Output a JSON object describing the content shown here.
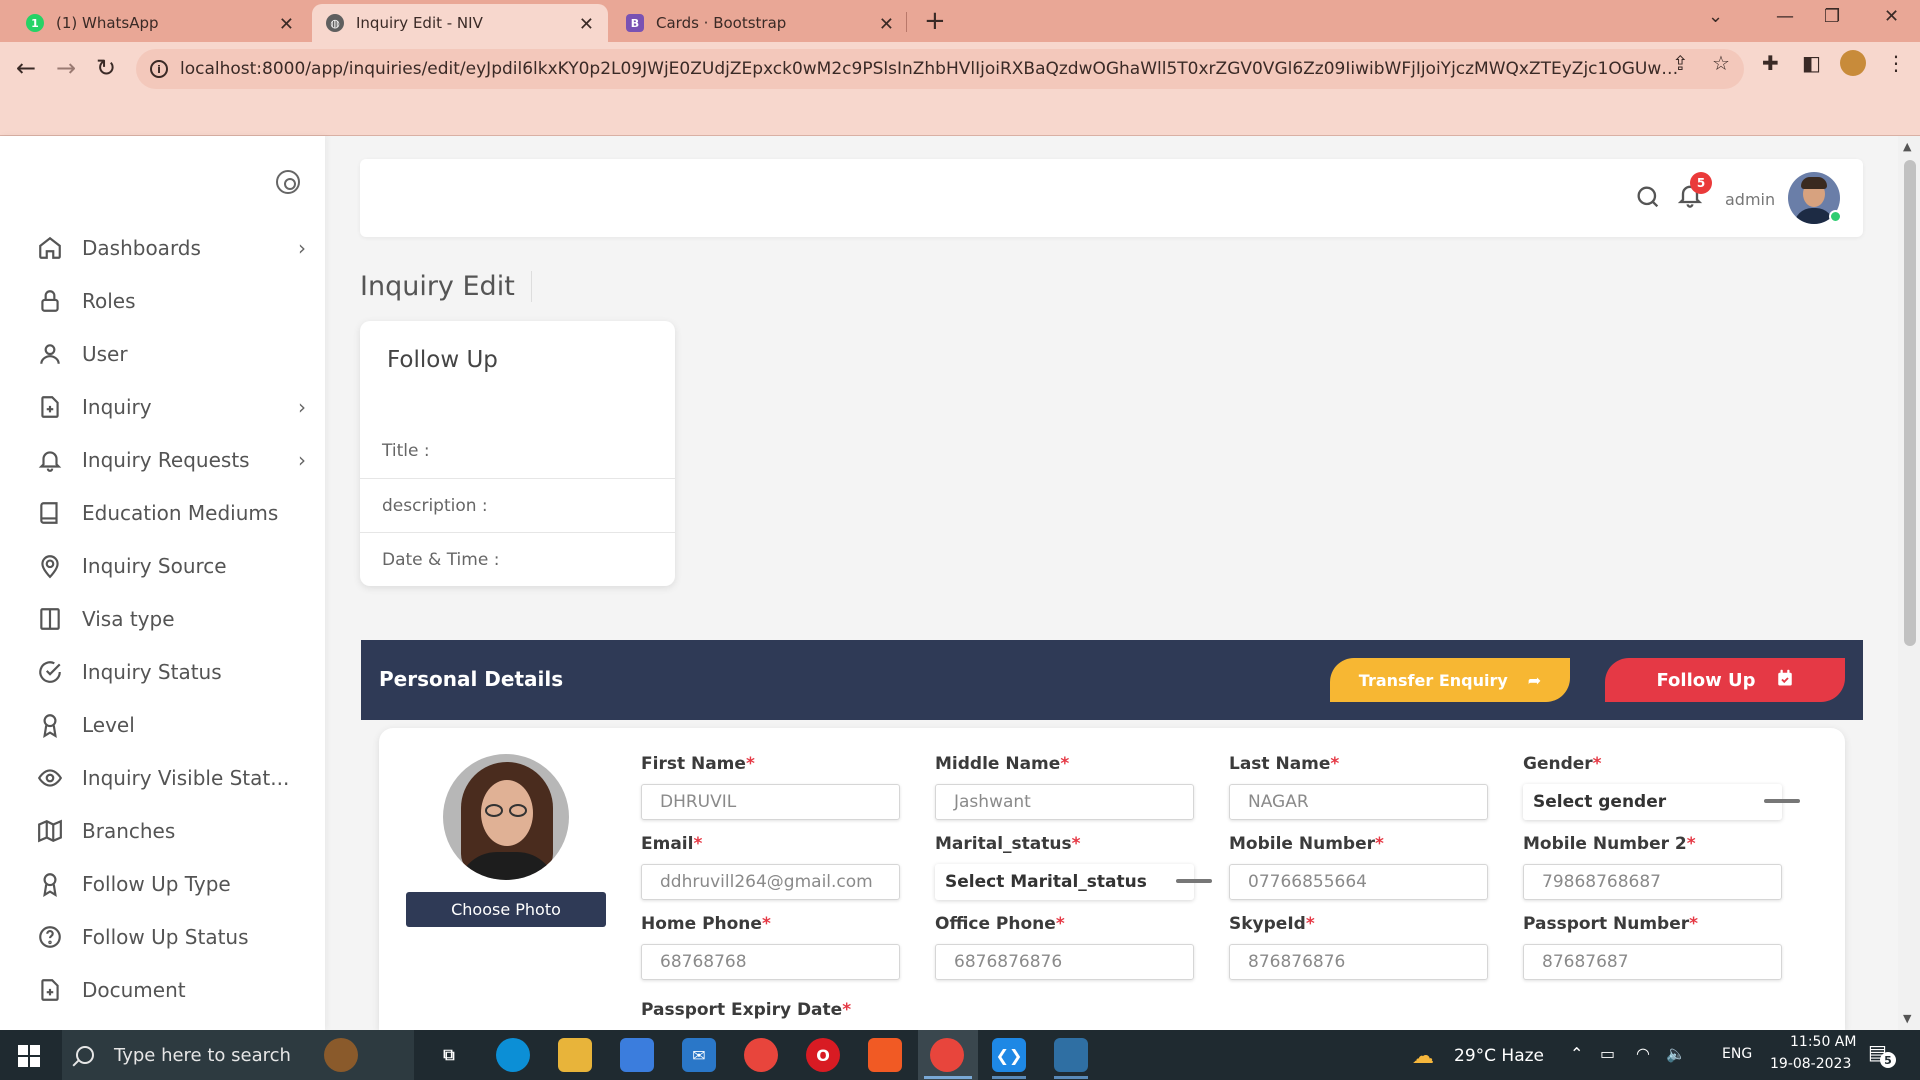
{
  "browser": {
    "tabs": [
      {
        "title": "(1) WhatsApp",
        "icon": "whatsapp-icon",
        "badge": "1"
      },
      {
        "title": "Inquiry Edit - NIV",
        "icon": "globe-icon"
      },
      {
        "title": "Cards · Bootstrap",
        "icon": "bootstrap-icon",
        "icon_letter": "B"
      }
    ],
    "url": "localhost:8000/app/inquiries/edit/eyJpdil6lkxKY0p2L09JWjE0ZUdjZEpxck0wM2c9PSlsInZhbHVlIjoiRXBaQzdwOGhaWll5T0xrZGV0VGl6Zz09IiwibWFjIjoiYjczMWQxZTEyZjc1OGUwNWM4ZTM1N..."
  },
  "sidebar": {
    "items": [
      {
        "label": "Dashboards",
        "has_chevron": true,
        "icon": "home-icon"
      },
      {
        "label": "Roles",
        "icon": "lock-icon"
      },
      {
        "label": "User",
        "icon": "user-icon"
      },
      {
        "label": "Inquiry",
        "has_chevron": true,
        "icon": "file-plus-icon"
      },
      {
        "label": "Inquiry Requests",
        "has_chevron": true,
        "icon": "bell-icon"
      },
      {
        "label": "Education Mediums",
        "icon": "book-icon"
      },
      {
        "label": "Inquiry Source",
        "icon": "map-pin-icon"
      },
      {
        "label": "Visa type",
        "icon": "columns-icon"
      },
      {
        "label": "Inquiry Status",
        "icon": "check-circle-icon"
      },
      {
        "label": "Level",
        "icon": "award-icon"
      },
      {
        "label": "Inquiry Visible Stat...",
        "icon": "eye-icon"
      },
      {
        "label": "Branches",
        "icon": "map-icon"
      },
      {
        "label": "Follow Up Type",
        "icon": "award-icon"
      },
      {
        "label": "Follow Up Status",
        "icon": "help-circle-icon"
      },
      {
        "label": "Document",
        "icon": "file-plus-icon"
      }
    ]
  },
  "topnav": {
    "notification_count": "5",
    "username": "admin"
  },
  "page": {
    "title": "Inquiry Edit"
  },
  "followup_card": {
    "title": "Follow Up",
    "rows": [
      "Title :",
      "description :",
      "Date & Time :"
    ]
  },
  "personal_details": {
    "title": "Personal Details",
    "transfer_button": "Transfer Enquiry",
    "followup_button": "Follow Up",
    "choose_photo": "Choose Photo",
    "fields": {
      "first_name": {
        "label": "First Name",
        "value": "DHRUVIL"
      },
      "middle_name": {
        "label": "Middle Name",
        "value": "Jashwant"
      },
      "last_name": {
        "label": "Last Name",
        "value": "NAGAR"
      },
      "gender": {
        "label": "Gender",
        "value": "Select gender"
      },
      "email": {
        "label": "Email",
        "value": "ddhruvill264@gmail.com"
      },
      "marital_status": {
        "label": "Marital_status",
        "value": "Select Marital_status"
      },
      "mobile": {
        "label": "Mobile Number",
        "value": "07766855664"
      },
      "mobile2": {
        "label": "Mobile Number 2",
        "value": "79868768687"
      },
      "home_phone": {
        "label": "Home Phone",
        "value": "68768768"
      },
      "office_phone": {
        "label": "Office Phone",
        "value": "6876876876"
      },
      "skype": {
        "label": "SkypeId",
        "value": "876876876"
      },
      "passport": {
        "label": "Passport Number",
        "value": "87687687"
      },
      "passport_expiry": {
        "label": "Passport Expiry Date"
      }
    },
    "required_mark": "*"
  },
  "taskbar": {
    "search_placeholder": "Type here to search",
    "weather": "29°C  Haze",
    "language": "ENG",
    "time": "11:50 AM",
    "date": "19-08-2023",
    "notification_count": "5"
  }
}
